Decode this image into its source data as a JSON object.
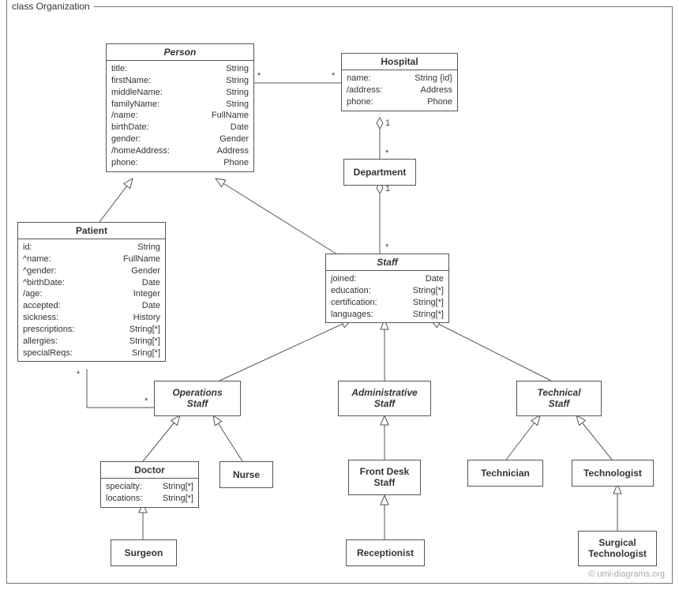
{
  "frame": {
    "title": "class Organization"
  },
  "classes": {
    "person": {
      "title": "Person",
      "attrs": [
        [
          "title:",
          "String"
        ],
        [
          "firstName:",
          "String"
        ],
        [
          "middleName:",
          "String"
        ],
        [
          "familyName:",
          "String"
        ],
        [
          "/name:",
          "FullName"
        ],
        [
          "birthDate:",
          "Date"
        ],
        [
          "gender:",
          "Gender"
        ],
        [
          "/homeAddress:",
          "Address"
        ],
        [
          "phone:",
          "Phone"
        ]
      ]
    },
    "hospital": {
      "title": "Hospital",
      "attrs": [
        [
          "name:",
          "String {id}"
        ],
        [
          "/address:",
          "Address"
        ],
        [
          "phone:",
          "Phone"
        ]
      ]
    },
    "department": {
      "title": "Department"
    },
    "patient": {
      "title": "Patient",
      "attrs": [
        [
          "id:",
          "String"
        ],
        [
          "^name:",
          "FullName"
        ],
        [
          "^gender:",
          "Gender"
        ],
        [
          "^birthDate:",
          "Date"
        ],
        [
          "/age:",
          "Integer"
        ],
        [
          "accepted:",
          "Date"
        ],
        [
          "sickness:",
          "History"
        ],
        [
          "prescriptions:",
          "String[*]"
        ],
        [
          "allergies:",
          "String[*]"
        ],
        [
          "specialReqs:",
          "Sring[*]"
        ]
      ]
    },
    "staff": {
      "title": "Staff",
      "attrs": [
        [
          "joined:",
          "Date"
        ],
        [
          "education:",
          "String[*]"
        ],
        [
          "certification:",
          "String[*]"
        ],
        [
          "languages:",
          "String[*]"
        ]
      ]
    },
    "opstaff": {
      "title": "Operations",
      "subtitle": "Staff"
    },
    "adminstaff": {
      "title": "Administrative",
      "subtitle": "Staff"
    },
    "techstaff": {
      "title": "Technical",
      "subtitle": "Staff"
    },
    "doctor": {
      "title": "Doctor",
      "attrs": [
        [
          "specialty:",
          "String[*]"
        ],
        [
          "locations:",
          "String[*]"
        ]
      ]
    },
    "nurse": {
      "title": "Nurse"
    },
    "frontdesk": {
      "title": "Front Desk",
      "subtitle": "Staff"
    },
    "receptionist": {
      "title": "Receptionist"
    },
    "technician": {
      "title": "Technician"
    },
    "technologist": {
      "title": "Technologist"
    },
    "surgtech": {
      "title": "Surgical",
      "subtitle": "Technologist"
    }
  },
  "mult": {
    "person_hospital_left": "*",
    "person_hospital_right": "*",
    "hospital_dept_top": "1",
    "hospital_dept_bottom": "*",
    "dept_staff_top": "1",
    "dept_staff_bottom": "*",
    "patient_ops_left": "*",
    "patient_ops_right": "*"
  },
  "watermark": "© uml-diagrams.org"
}
